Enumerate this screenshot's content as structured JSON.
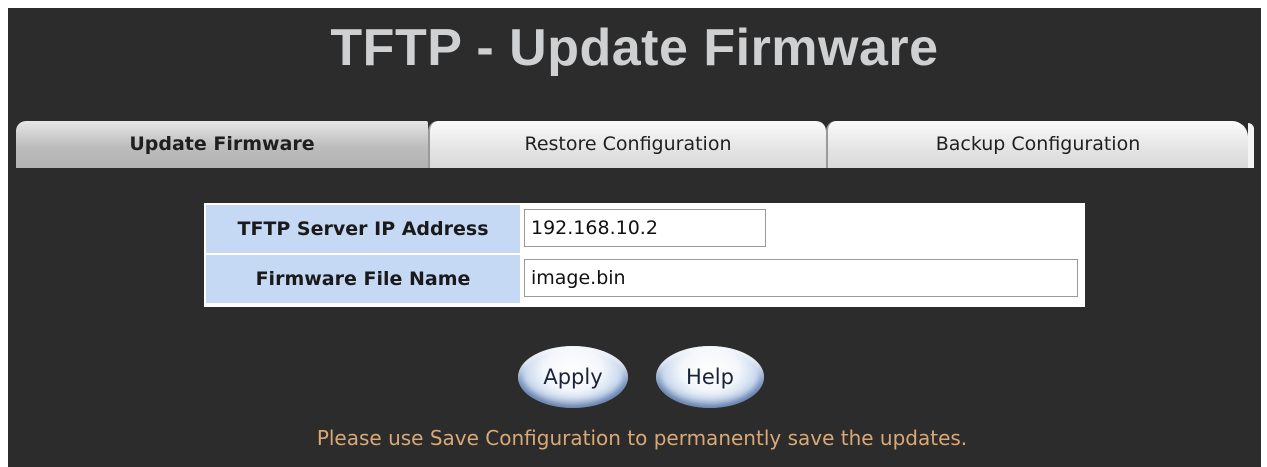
{
  "page": {
    "title": "TFTP - Update Firmware"
  },
  "tabs": [
    {
      "label": "Update Firmware",
      "active": true
    },
    {
      "label": "Restore Configuration",
      "active": false
    },
    {
      "label": "Backup Configuration",
      "active": false
    }
  ],
  "form": {
    "server_ip": {
      "label": "TFTP Server IP Address",
      "value": "192.168.10.2"
    },
    "file_name": {
      "label": "Firmware File Name",
      "value": "image.bin"
    }
  },
  "buttons": {
    "apply_label": "Apply",
    "help_label": "Help"
  },
  "note": "Please use Save Configuration to permanently save the updates.",
  "colors": {
    "background": "#2c2c2c",
    "title": "#cfd0d2",
    "label_cell": "#c5d8f4",
    "note_text": "#d9a876",
    "button_blue": "#3d5f98"
  }
}
